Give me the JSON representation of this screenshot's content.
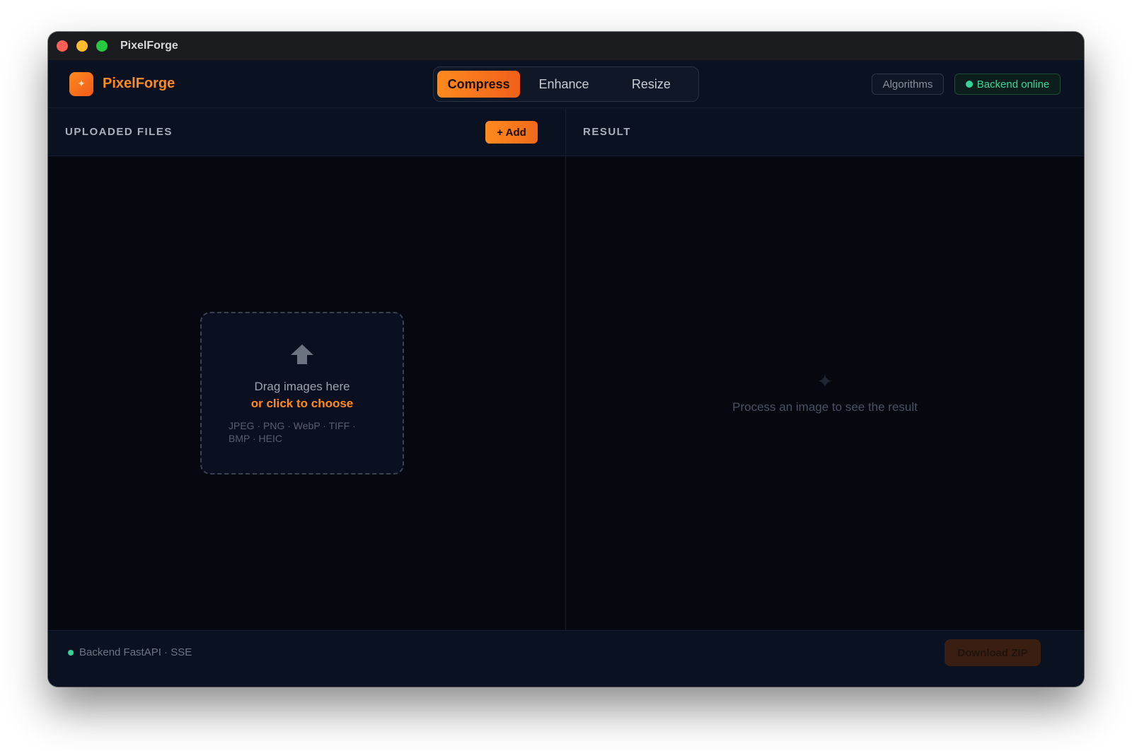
{
  "window": {
    "title": "PixelForge"
  },
  "header": {
    "logo_text": "PixelForge",
    "tabs": [
      {
        "label": "Compress",
        "active": true
      },
      {
        "label": "Enhance",
        "active": false
      },
      {
        "label": "Resize",
        "active": false
      }
    ],
    "algorithms_label": "Algorithms",
    "backend_status": "Backend online"
  },
  "left_panel": {
    "title": "UPLOADED FILES",
    "add_label": "+ Add",
    "dropzone": {
      "title": "Drag images here",
      "link": "or click to choose",
      "formats": "JPEG · PNG · WebP · TIFF · BMP · HEIC"
    }
  },
  "right_panel": {
    "title": "RESULT",
    "empty_text": "Process an image to see the result"
  },
  "footer": {
    "status_text": "Backend FastAPI · SSE",
    "download_label": "Download ZIP"
  },
  "colors": {
    "accent": "#ff8a1f",
    "online": "#34d399",
    "background": "#05080f"
  },
  "icons": {
    "logo": "sparkle-icon",
    "upload": "upload-arrow-icon",
    "result_placeholder": "sparkle-icon"
  }
}
